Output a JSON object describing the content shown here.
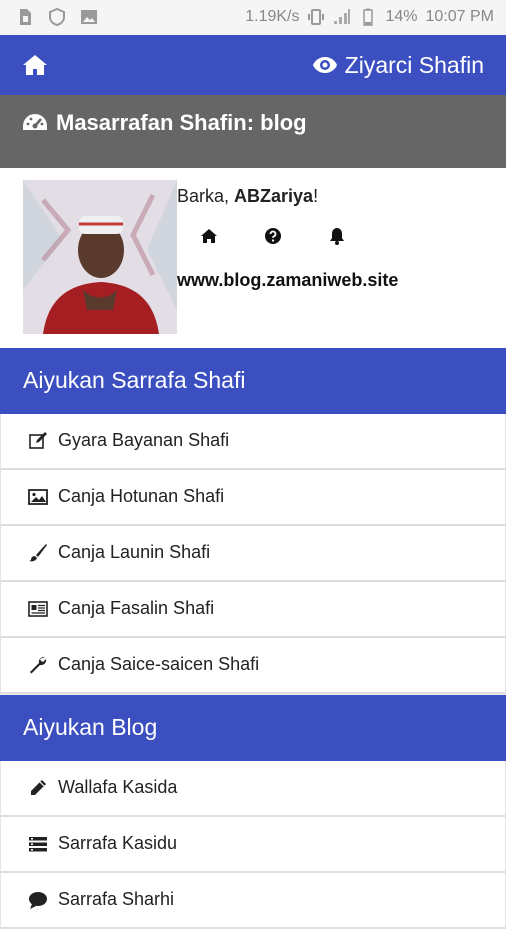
{
  "statusbar": {
    "speed": "1.19K/s",
    "battery": "14%",
    "time": "10:07 PM"
  },
  "topnav": {
    "visit_label": "Ziyarci Shafin"
  },
  "dashboard": {
    "title": "Masarrafan Shafin: blog"
  },
  "profile": {
    "greeting_prefix": "Barka, ",
    "username": "ABZariya",
    "greeting_suffix": "!",
    "site": "www.blog.zamaniweb.site"
  },
  "page_section": {
    "title": "Aiyukan Sarrafa Shafi",
    "items": [
      {
        "label": "Gyara Bayanan Shafi",
        "icon": "edit-icon"
      },
      {
        "label": "Canja Hotunan Shafi",
        "icon": "image-icon"
      },
      {
        "label": "Canja Launin Shafi",
        "icon": "brush-icon"
      },
      {
        "label": "Canja Fasalin Shafi",
        "icon": "layout-icon"
      },
      {
        "label": "Canja Saice-saicen Shafi",
        "icon": "wrench-icon"
      }
    ]
  },
  "blog_section": {
    "title": "Aiyukan Blog",
    "items": [
      {
        "label": "Wallafa Kasida",
        "icon": "pencil-icon"
      },
      {
        "label": "Sarrafa Kasidu",
        "icon": "list-icon"
      },
      {
        "label": "Sarrafa Sharhi",
        "icon": "comment-icon"
      }
    ]
  },
  "colors": {
    "primary": "#3c4fc0",
    "header_gray": "#666666"
  }
}
